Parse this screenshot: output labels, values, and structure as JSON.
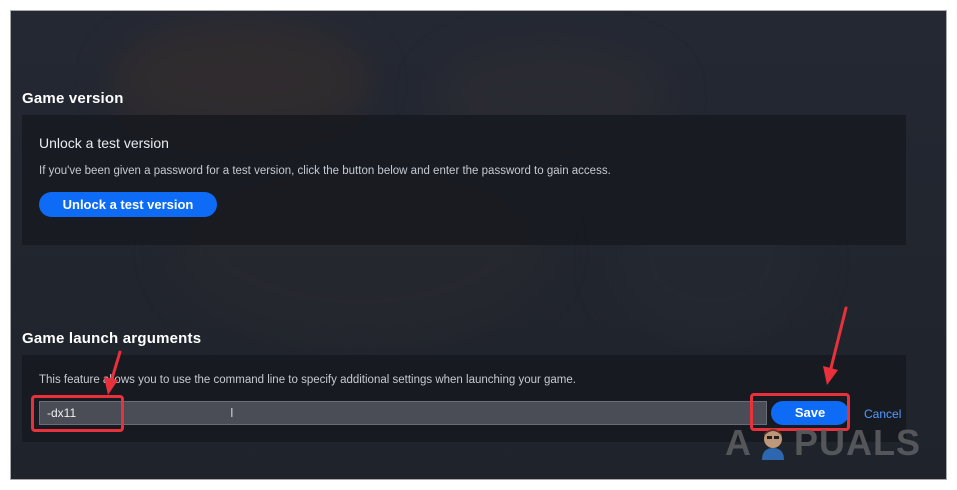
{
  "game_version": {
    "title": "Game version",
    "card_heading": "Unlock a test version",
    "description": "If you've been given a password for a test version, click the button below and enter the password to gain access.",
    "unlock_button_label": "Unlock a test version"
  },
  "launch_arguments": {
    "title": "Game launch arguments",
    "description": "This feature allows you to use the command line to specify additional settings when launching your game.",
    "input_value": "-dx11",
    "save_label": "Save",
    "cancel_label": "Cancel"
  },
  "watermark": {
    "left_text": "A",
    "right_text": "PUALS"
  },
  "colors": {
    "accent_blue": "#0d6bf5",
    "annotation_red": "#e8313a",
    "link_blue": "#4f9bff"
  },
  "icons": [
    "text-cursor-icon",
    "annotation-arrow-icon",
    "appuals-mascot-icon"
  ]
}
